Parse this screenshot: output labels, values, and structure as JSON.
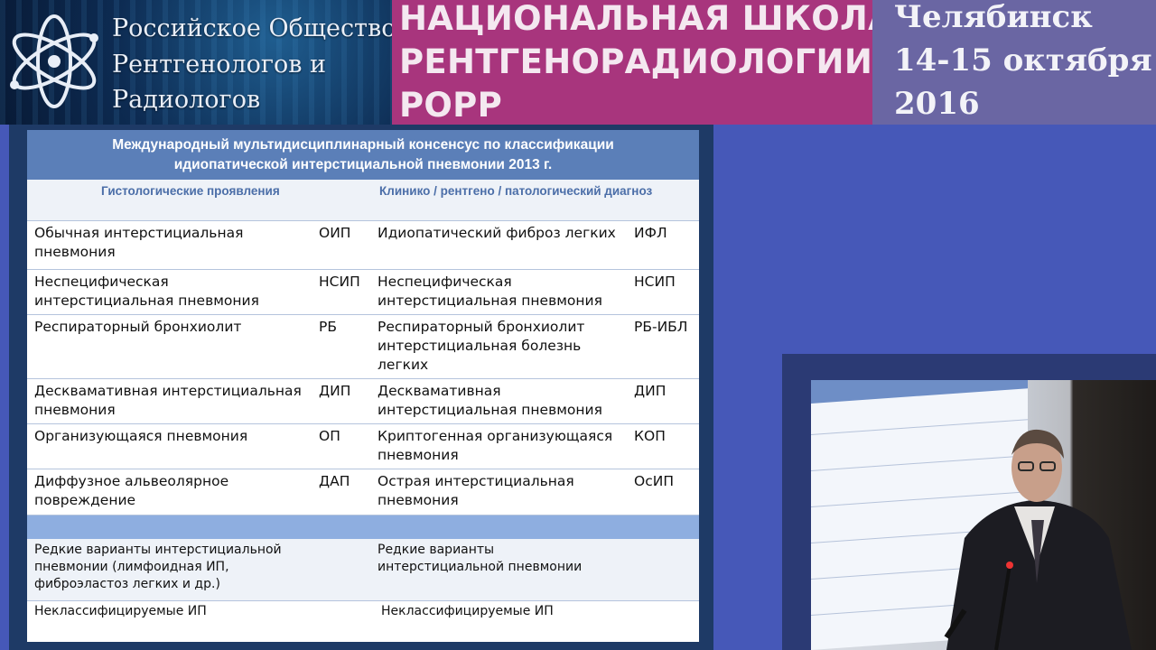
{
  "header": {
    "org_lines": [
      "Российское Общество",
      "Рентгенологов и",
      "Радиологов"
    ],
    "school_lines": [
      "НАЦИОНАЛЬНАЯ ШКОЛА",
      "РЕНТГЕНОРАДИОЛОГИИ",
      "РОРР"
    ],
    "place_lines": [
      "Челябинск",
      "14-15 октября",
      "2016"
    ]
  },
  "slide": {
    "title_line1": "Международный мультидисциплинарный консенсус по классификации",
    "title_line2": "идиопатической интерстициальной пневмонии 2013 г.",
    "col_left": "Гистологические проявления",
    "col_right": "Клинико / рентгено / патологический диагноз",
    "rows": [
      {
        "histo": [
          "Обычная интерстициальная",
          "пневмония"
        ],
        "histo_abbr": "ОИП",
        "diag": [
          "Идиопатический фиброз легких"
        ],
        "diag_abbr": "ИФЛ"
      },
      {
        "histo": [
          "Неспецифическая",
          "интерстициальная пневмония"
        ],
        "histo_abbr": "НСИП",
        "diag": [
          "Неспецифическая",
          "интерстициальная пневмония"
        ],
        "diag_abbr": "НСИП"
      },
      {
        "histo": [
          "Респираторный бронхиолит"
        ],
        "histo_abbr": "РБ",
        "diag": [
          "Респираторный бронхиолит",
          "интерстициальная болезнь",
          "легких"
        ],
        "diag_abbr": "РБ-ИБЛ"
      },
      {
        "histo": [
          "Десквамативная интерстициальная",
          "пневмония"
        ],
        "histo_abbr": "ДИП",
        "diag": [
          "Десквамативная",
          "интерстициальная пневмония"
        ],
        "diag_abbr": "ДИП"
      },
      {
        "histo": [
          "Организующаяся пневмония"
        ],
        "histo_abbr": "ОП",
        "diag": [
          "Криптогенная организующаяся",
          "пневмония"
        ],
        "diag_abbr": "КОП"
      },
      {
        "histo": [
          "Диффузное альвеолярное",
          "повреждение"
        ],
        "histo_abbr": "ДАП",
        "diag": [
          "Острая интерстициальная",
          "пневмония"
        ],
        "diag_abbr": "ОсИП"
      }
    ],
    "rare_left": [
      "Редкие варианты интерстициальной",
      "пневмонии (лимфоидная ИП,",
      "фиброэластоз легких и др.)"
    ],
    "rare_right": [
      "Редкие варианты",
      "интерстициальной  пневмонии"
    ],
    "unclass_left": "Неклассифицируемые  ИП",
    "unclass_right": "Неклассифицируемые  ИП"
  }
}
